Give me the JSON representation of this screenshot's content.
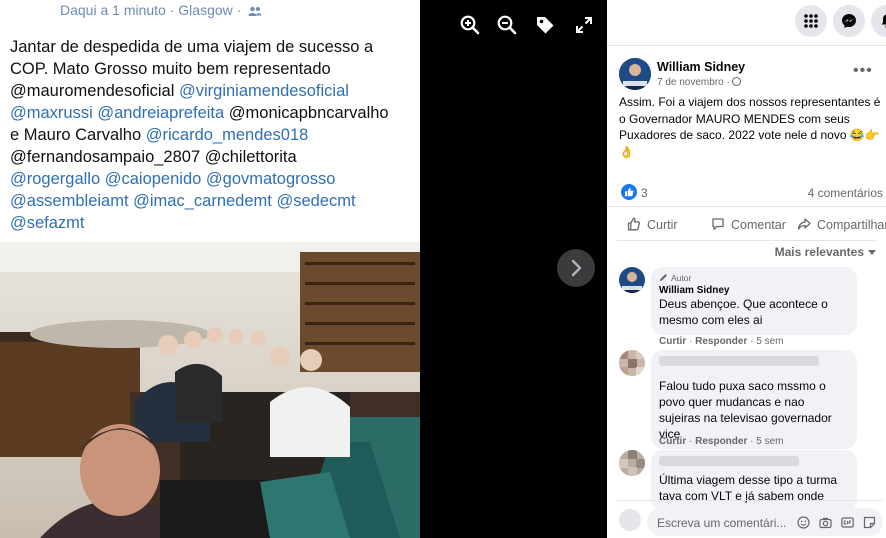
{
  "shot": {
    "meta": "Daqui a 1 minuto · Glasgow ·",
    "people_icon": "people-icon",
    "caption_lines": [
      [
        {
          "t": "Jantar de despedida de uma viajem de sucesso a",
          "k": "text"
        }
      ],
      [
        {
          "t": "COP. Mato Grosso muito bem representado",
          "k": "text"
        }
      ],
      [
        {
          "t": "@mauromendesoficial",
          "k": "text"
        },
        {
          "t": " ",
          "k": "text"
        },
        {
          "t": "@virginiamendesoficial",
          "k": "tag"
        }
      ],
      [
        {
          "t": "@maxrussi",
          "k": "tag"
        },
        {
          "t": " ",
          "k": "text"
        },
        {
          "t": "@andreiaprefeita",
          "k": "tag"
        },
        {
          "t": " @monicapbncarvalho",
          "k": "text"
        }
      ],
      [
        {
          "t": "e Mauro Carvalho ",
          "k": "text"
        },
        {
          "t": "@ricardo_mendes018",
          "k": "tag"
        }
      ],
      [
        {
          "t": "@fernandosampaio_2807 @chilettorita",
          "k": "text"
        }
      ],
      [
        {
          "t": "@rogergallo",
          "k": "tag"
        },
        {
          "t": " ",
          "k": "text"
        },
        {
          "t": "@caiopenido",
          "k": "tag"
        },
        {
          "t": " ",
          "k": "text"
        },
        {
          "t": "@govmatogrosso",
          "k": "tag"
        }
      ],
      [
        {
          "t": "@assembleiamt",
          "k": "tag"
        },
        {
          "t": " ",
          "k": "text"
        },
        {
          "t": "@imac_carnedemt",
          "k": "tag"
        },
        {
          "t": " ",
          "k": "text"
        },
        {
          "t": "@sedecmt",
          "k": "tag"
        }
      ],
      [
        {
          "t": "@sefazmt",
          "k": "tag"
        }
      ]
    ],
    "photo_alt": "restaurant-group-selfie"
  },
  "viewer_tools": [
    "zoom-in-icon",
    "zoom-out-icon",
    "tag-icon",
    "fullscreen-icon"
  ],
  "top_icons": [
    "menu-grid-icon",
    "messenger-icon",
    "notifications-icon"
  ],
  "post": {
    "author": "William Sidney",
    "date": "7 de novembro ·",
    "text": "Assim. Foi a viajem dos nossos representantes é o Governador MAURO MENDES com seus Puxadores de saco. 2022 vote nele d novo 😂👉👌",
    "reaction_count": "3",
    "comment_count": "4 comentários",
    "actions": {
      "like": "Curtir",
      "comment": "Comentar",
      "share": "Compartilhar"
    },
    "sort_label": "Mais relevantes"
  },
  "comments": [
    {
      "badge": "Autor",
      "name": "William Sidney",
      "text": "Deus abençoe. Que acontece o mesmo com eles ai",
      "like": "Curtir",
      "reply": "Responder",
      "time": "5 sem"
    },
    {
      "text": "Falou tudo puxa saco mssmo o povo quer mudancas e nao sujeiras na televisao governador vice",
      "like": "Curtir",
      "reply": "Responder",
      "time": "5 sem"
    },
    {
      "text": "Última viagem desse tipo a turma tava com VLT e já sabem onde"
    }
  ],
  "compose": {
    "placeholder": "Escreva um comentári..."
  },
  "colors": {
    "accent": "#1877f2",
    "tag_blue": "#2f6fb4",
    "panel_bg": "#ffffff",
    "bubble": "#f0f2f5"
  }
}
